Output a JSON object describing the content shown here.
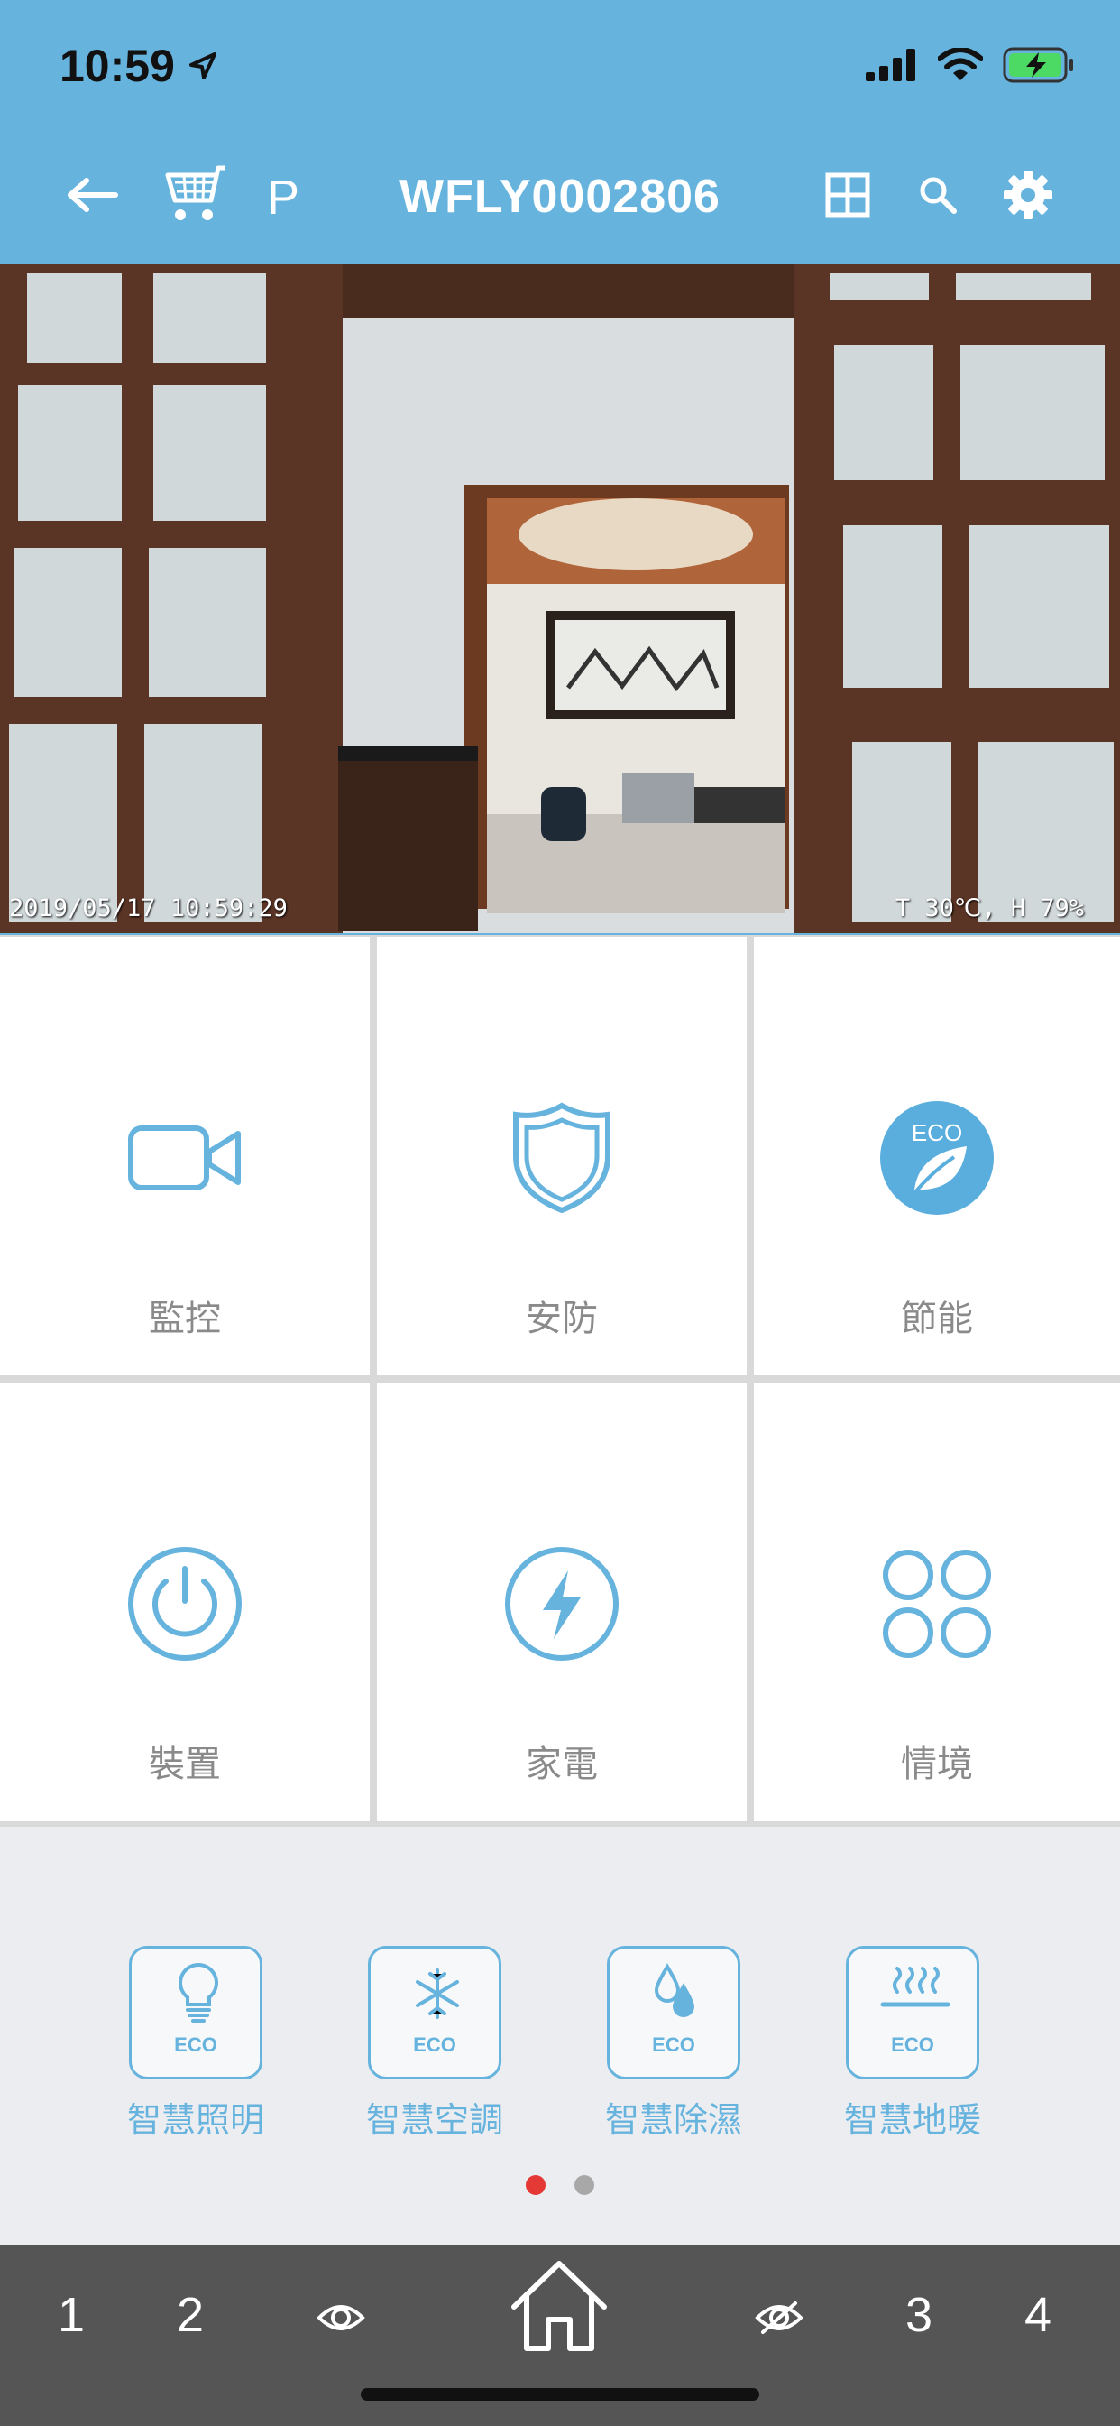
{
  "status_bar": {
    "time": "10:59"
  },
  "header": {
    "title": "WFLY0002806",
    "parking_label": "P"
  },
  "camera": {
    "timestamp": "2019/05/17 10:59:29",
    "environment": "T 30℃, H 79%"
  },
  "tiles": [
    {
      "label": "監控",
      "icon": "video-camera-icon"
    },
    {
      "label": "安防",
      "icon": "shield-icon"
    },
    {
      "label": "節能",
      "icon": "eco-leaf-icon"
    },
    {
      "label": "裝置",
      "icon": "power-icon"
    },
    {
      "label": "家電",
      "icon": "lightning-icon"
    },
    {
      "label": "情境",
      "icon": "four-circles-icon"
    }
  ],
  "eco_items": [
    {
      "label": "智慧照明",
      "badge": "ECO",
      "icon": "bulb-icon"
    },
    {
      "label": "智慧空調",
      "badge": "ECO",
      "icon": "snowflake-icon"
    },
    {
      "label": "智慧除濕",
      "badge": "ECO",
      "icon": "droplet-icon"
    },
    {
      "label": "智慧地暖",
      "badge": "ECO",
      "icon": "floor-heat-icon"
    }
  ],
  "pager": {
    "active_color": "#e53935",
    "inactive_color": "#a8a8a8"
  },
  "tabs": [
    "1",
    "2",
    "3",
    "4"
  ],
  "colors": {
    "accent": "#66b3de",
    "bar": "#555555"
  }
}
